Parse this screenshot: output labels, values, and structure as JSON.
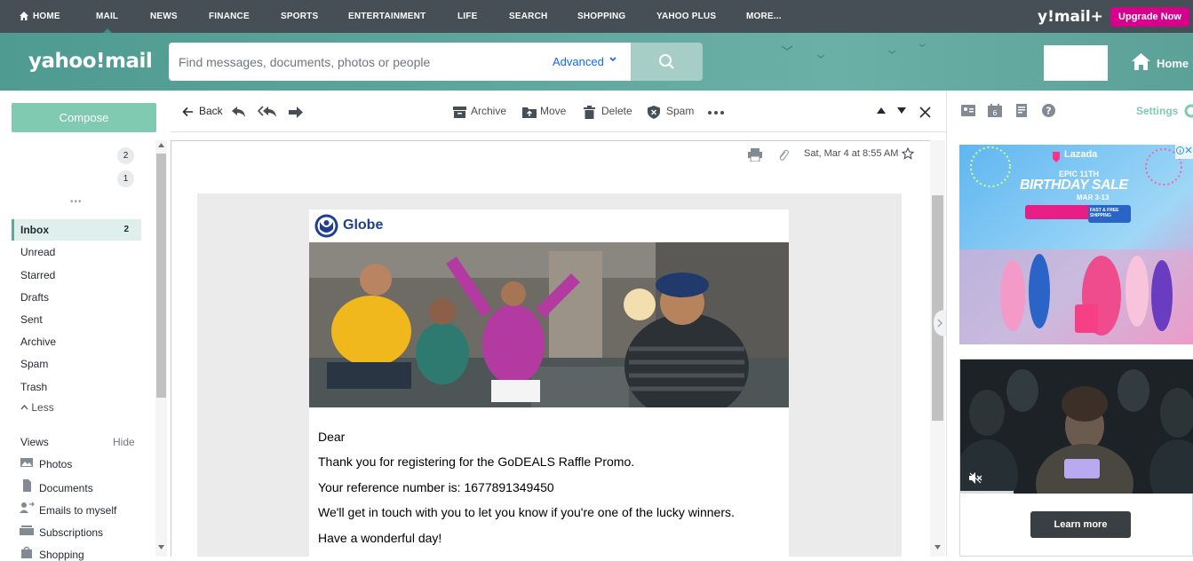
{
  "topnav": {
    "items": [
      "HOME",
      "MAIL",
      "NEWS",
      "FINANCE",
      "SPORTS",
      "ENTERTAINMENT",
      "LIFE",
      "SEARCH",
      "SHOPPING",
      "YAHOO PLUS",
      "MORE..."
    ],
    "brand": "y!mail+",
    "upgrade_label": "Upgrade Now"
  },
  "header": {
    "logo": "yahoo!mail",
    "search_placeholder": "Find messages, documents, photos or people",
    "advanced_label": "Advanced",
    "home_label": "Home"
  },
  "sidebar": {
    "compose_label": "Compose",
    "account_badges": [
      "2",
      "1"
    ],
    "folders": [
      {
        "label": "Inbox",
        "count": "2"
      },
      {
        "label": "Unread",
        "count": ""
      },
      {
        "label": "Starred",
        "count": ""
      },
      {
        "label": "Drafts",
        "count": ""
      },
      {
        "label": "Sent",
        "count": ""
      },
      {
        "label": "Archive",
        "count": ""
      },
      {
        "label": "Spam",
        "count": ""
      },
      {
        "label": "Trash",
        "count": ""
      }
    ],
    "less_label": "Less",
    "views_label": "Views",
    "hide_label": "Hide",
    "views": [
      {
        "label": "Photos",
        "icon": "photos-icon"
      },
      {
        "label": "Documents",
        "icon": "document-icon"
      },
      {
        "label": "Emails to myself",
        "icon": "user-arrow-icon"
      },
      {
        "label": "Subscriptions",
        "icon": "subscriptions-icon"
      },
      {
        "label": "Shopping",
        "icon": "shopping-bag-icon"
      }
    ]
  },
  "toolbar": {
    "back_label": "Back",
    "archive_label": "Archive",
    "move_label": "Move",
    "delete_label": "Delete",
    "spam_label": "Spam"
  },
  "message": {
    "date": "Sat, Mar 4 at 8:55 AM",
    "sender_brand": "Globe",
    "lines": [
      "Dear",
      "Thank you for registering for the GoDEALS Raffle Promo.",
      "Your reference number is: 1677891349450",
      "We'll get in touch with you to let you know if you're one of the lucky winners.",
      "Have a wonderful day!"
    ]
  },
  "rightrail": {
    "settings_label": "Settings",
    "ad1": {
      "brand": "Lazada",
      "headline": "EPIC 11TH",
      "title": "BIRTHDAY SALE",
      "dates": "MAR 3-13",
      "badge": "FAST & FREE SHIPPING"
    },
    "ad2": {
      "learn_more_label": "Learn more"
    }
  },
  "colors": {
    "nav_bg": "#464e56",
    "header_teal": "#5ea69c",
    "compose": "#7fcab0",
    "upgrade": "#d6008d",
    "link_blue": "#0f69ff"
  }
}
